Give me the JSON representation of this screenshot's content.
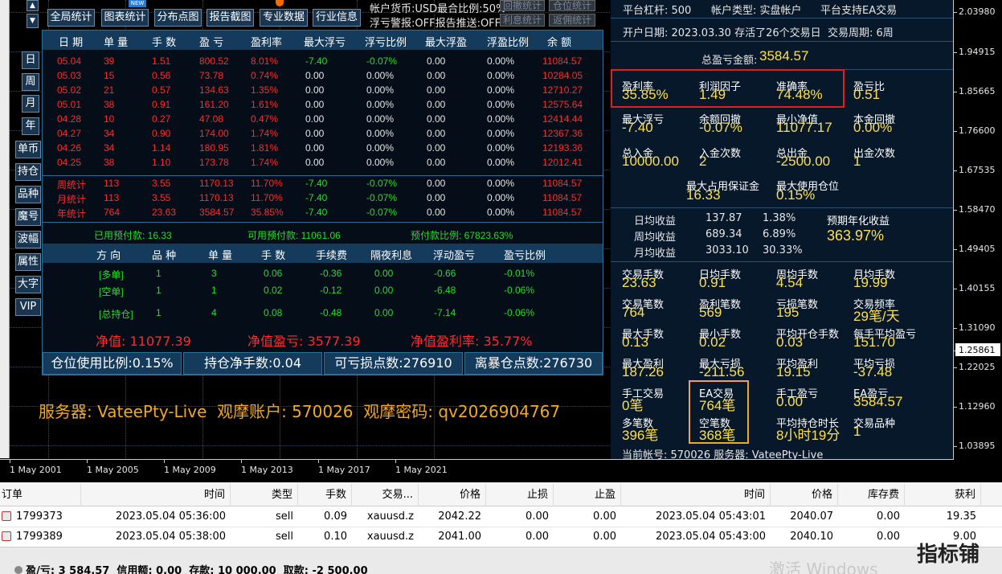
{
  "top_buttons": [
    "全局统计",
    "图表统计",
    "分布点图",
    "报告截图",
    "专业数据",
    "行业信息"
  ],
  "new_badge": "NEW",
  "account_info": {
    "line1": "帐户货币:USD最合比例:50%",
    "line2": "浮亏警报:OFF报告推送:OFF",
    "btn1": "回撤统计",
    "btn2": "仓位统计",
    "btn3": "利息统计",
    "btn4": "返佣统计"
  },
  "period_buttons": [
    "日",
    "周",
    "月",
    "年"
  ],
  "side_buttons": [
    "单币",
    "持仓",
    "品种",
    "魔号",
    "波幅",
    "属性",
    "大字",
    "VIP"
  ],
  "table": {
    "headers": [
      "日 期",
      "单 量",
      "手 数",
      "盈 亏",
      "盈利率",
      "最大浮亏",
      "浮亏比例",
      "最大浮盈",
      "浮盈比例",
      "余 额"
    ],
    "rows": [
      [
        "05.04",
        "39",
        "1.51",
        "800.52",
        "8.01%",
        "-7.40",
        "-0.07%",
        "0.00",
        "0.00%",
        "11084.57"
      ],
      [
        "05.03",
        "15",
        "0.56",
        "73.78",
        "0.74%",
        "0.00",
        "0.00%",
        "0.00",
        "0.00%",
        "10284.05"
      ],
      [
        "05.02",
        "21",
        "0.57",
        "134.63",
        "1.35%",
        "0.00",
        "0.00%",
        "0.00",
        "0.00%",
        "12710.27"
      ],
      [
        "05.01",
        "38",
        "0.91",
        "161.20",
        "1.61%",
        "0.00",
        "0.00%",
        "0.00",
        "0.00%",
        "12575.64"
      ],
      [
        "04.28",
        "10",
        "0.27",
        "47.08",
        "0.47%",
        "0.00",
        "0.00%",
        "0.00",
        "0.00%",
        "12414.44"
      ],
      [
        "04.27",
        "34",
        "0.90",
        "174.00",
        "1.74%",
        "0.00",
        "0.00%",
        "0.00",
        "0.00%",
        "12367.36"
      ],
      [
        "04.26",
        "34",
        "1.14",
        "180.95",
        "1.81%",
        "0.00",
        "0.00%",
        "0.00",
        "0.00%",
        "12193.36"
      ],
      [
        "04.25",
        "38",
        "1.10",
        "173.78",
        "1.74%",
        "0.00",
        "0.00%",
        "0.00",
        "0.00%",
        "12012.41"
      ]
    ],
    "summary": [
      [
        "周统计",
        "113",
        "3.55",
        "1170.13",
        "11.70%",
        "-7.40",
        "-0.07%",
        "0.00",
        "0.00%",
        "11084.57"
      ],
      [
        "月统计",
        "113",
        "3.55",
        "1170.13",
        "11.70%",
        "-7.40",
        "-0.07%",
        "0.00",
        "0.00%",
        "11084.57"
      ],
      [
        "年统计",
        "764",
        "23.63",
        "3584.57",
        "35.85%",
        "-7.40",
        "-0.07%",
        "0.00",
        "0.00%",
        "11084.57"
      ]
    ],
    "prepay": {
      "used": "已用预付款: 16.33",
      "avail": "可用预付款: 11061.06",
      "ratio": "预付款比例: 67823.63%"
    },
    "pos_headers": [
      "方 向",
      "品 种",
      "单 量",
      "手 数",
      "手续费",
      "隔夜利息",
      "浮动盈亏",
      "盈亏比例"
    ],
    "pos_rows": [
      [
        "[多单]",
        "1",
        "3",
        "0.06",
        "-0.36",
        "0.00",
        "-0.66",
        "-0.01%"
      ],
      [
        "[空单]",
        "1",
        "1",
        "0.02",
        "-0.12",
        "0.00",
        "-6.48",
        "-0.06%"
      ],
      [
        "[总持仓]",
        "1",
        "4",
        "0.08",
        "-0.48",
        "0.00",
        "-7.14",
        "-0.06%"
      ]
    ],
    "equity": "净值: 11077.39",
    "equity_pl": "净值盈亏: 3577.39",
    "equity_rate": "净值盈利率: 35.77%",
    "bottom_bar": [
      "仓位使用比例:0.15%",
      "持仓净手数:0.04",
      "可亏损点数:276910",
      "离暴仓点数:276730"
    ]
  },
  "server_line": "服务器: VateePty-Live  观摩账户: 570026  观摩密码: qv2026904767",
  "stats": {
    "leverage": "平台杠杆: 500",
    "acct_type": "帐户类型: 实盘帐户",
    "ea_support": "平台支持EA交易",
    "open_date": "开户日期: 2023.03.30 存活了26个交易日",
    "cycle": "交易周期: 6周",
    "total_pl_label": "总盈亏金额:",
    "total_pl": "3584.57",
    "grid1": [
      {
        "l": "盈利率",
        "v": "35.85%"
      },
      {
        "l": "利润因子",
        "v": "1.49"
      },
      {
        "l": "准确率",
        "v": "74.48%"
      },
      {
        "l": "盈亏比",
        "v": "0.51"
      }
    ],
    "grid2": [
      {
        "l": "最大浮亏",
        "v": "-7.40"
      },
      {
        "l": "余额回撤",
        "v": "-0.07%"
      },
      {
        "l": "最小净值",
        "v": "11077.17"
      },
      {
        "l": "本金回撤",
        "v": "0.00%"
      }
    ],
    "grid3": [
      {
        "l": "总入金",
        "v": "10000.00"
      },
      {
        "l": "入金次数",
        "v": "2"
      },
      {
        "l": "总出金",
        "v": "-2500.00"
      },
      {
        "l": "出金次数",
        "v": "1"
      }
    ],
    "max_margin_l": "最大占用保证金",
    "max_margin_v": "16.33",
    "max_pos_l": "最大使用仓位",
    "max_pos_v": "0.15%",
    "income": [
      [
        "日均收益",
        "137.87",
        "1.38%"
      ],
      [
        "周均收益",
        "689.34",
        "6.89%"
      ],
      [
        "月均收益",
        "3033.10",
        "30.33%"
      ]
    ],
    "annual_l": "预期年化收益",
    "annual_v": "363.97%",
    "grid4": [
      {
        "l": "交易手数",
        "v": "23.63"
      },
      {
        "l": "日均手数",
        "v": "0.91"
      },
      {
        "l": "周均手数",
        "v": "4.54"
      },
      {
        "l": "月均手数",
        "v": "19.99"
      },
      {
        "l": "交易笔数",
        "v": "764"
      },
      {
        "l": "盈利笔数",
        "v": "569"
      },
      {
        "l": "亏损笔数",
        "v": "195"
      },
      {
        "l": "交易频率",
        "v": "29笔/天"
      },
      {
        "l": "最大手数",
        "v": "0.13"
      },
      {
        "l": "最小手数",
        "v": "0.02"
      },
      {
        "l": "平均开仓手数",
        "v": "0.03"
      },
      {
        "l": "每手平均盈亏",
        "v": "151.70"
      },
      {
        "l": "最大盈利",
        "v": "187.26"
      },
      {
        "l": "最大亏损",
        "v": "-211.56"
      },
      {
        "l": "平均盈利",
        "v": "19.15"
      },
      {
        "l": "平均亏损",
        "v": "-37.48"
      },
      {
        "l": "手工交易",
        "v": "0笔"
      },
      {
        "l": "EA交易",
        "v": "764笔"
      },
      {
        "l": "手工盈亏",
        "v": "0.00"
      },
      {
        "l": "EA盈亏",
        "v": "3584.57"
      },
      {
        "l": "多笔数",
        "v": "396笔"
      },
      {
        "l": "空笔数",
        "v": "368笔"
      },
      {
        "l": "平均持仓时长",
        "v": "8小时19分"
      },
      {
        "l": "交易品种",
        "v": "1"
      }
    ],
    "footer": "当前帐号: 570026  服务器: VateePty-Live"
  },
  "price_axis": [
    "2.03980",
    "1.94915",
    "1.85665",
    "1.76600",
    "1.67535",
    "1.58470",
    "1.49405",
    "1.40155",
    "1.31090",
    "1.25861",
    "1.22025",
    "1.12960",
    "1.03895"
  ],
  "time_axis": [
    "1 May 2001",
    "1 May 2005",
    "1 May 2009",
    "1 May 2013",
    "1 May 2017",
    "1 May 2021"
  ],
  "orders": {
    "headers": [
      "订单",
      "时间",
      "类型",
      "手数",
      "交易...",
      "价格",
      "止损",
      "止盈",
      "时间",
      "价格",
      "库存费",
      "获利"
    ],
    "rows": [
      [
        "1799373",
        "2023.05.04 05:36:00",
        "sell",
        "0.09",
        "xauusd.z",
        "2042.22",
        "0.00",
        "0.00",
        "2023.05.04 05:43:01",
        "2040.07",
        "0.00",
        "19.35"
      ],
      [
        "1799389",
        "2023.05.04 05:38:00",
        "sell",
        "0.10",
        "xauusd.z",
        "2041.00",
        "0.00",
        "0.00",
        "2023.05.04 05:43:00",
        "2040.10",
        "0.00",
        "9.00"
      ]
    ],
    "summary": "盈/亏: 3 584.57  信用额: 0.00  存款: 10 000.00  取款: -2 500.00"
  },
  "watermark": "激活 Windows",
  "logo": "指标铺"
}
